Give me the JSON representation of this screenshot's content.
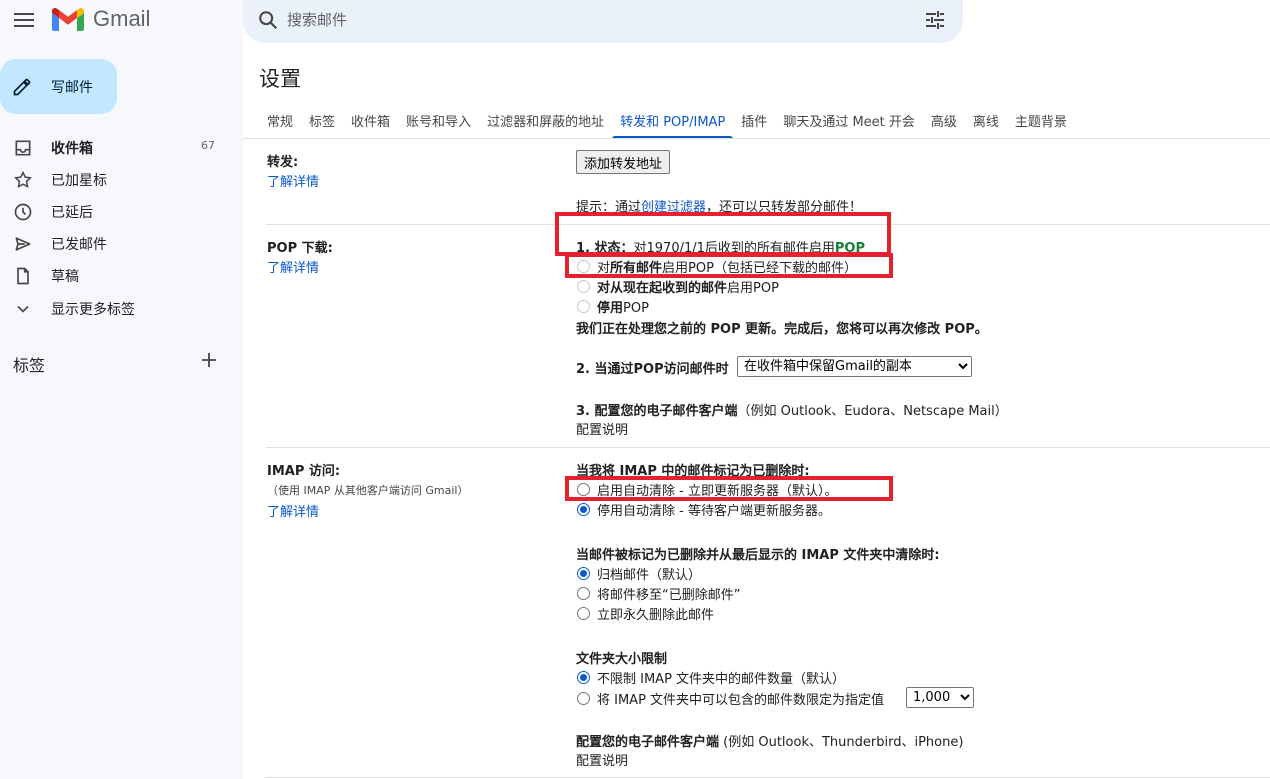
{
  "app": {
    "brand": "Gmail"
  },
  "search": {
    "placeholder": "搜索邮件"
  },
  "compose": {
    "label": "写邮件"
  },
  "nav": [
    {
      "label": "收件箱",
      "count": "67"
    },
    {
      "label": "已加星标"
    },
    {
      "label": "已延后"
    },
    {
      "label": "已发邮件"
    },
    {
      "label": "草稿"
    },
    {
      "label": "显示更多标签"
    }
  ],
  "labels_section": {
    "title": "标签"
  },
  "page": {
    "title": "设置"
  },
  "tabs": [
    "常规",
    "标签",
    "收件箱",
    "账号和导入",
    "过滤器和屏蔽的地址",
    "转发和 POP/IMAP",
    "插件",
    "聊天及通过 Meet 开会",
    "高级",
    "离线",
    "主题背景"
  ],
  "active_tab": "转发和 POP/IMAP",
  "forwarding": {
    "label": "转发:",
    "learn_more": "了解详情",
    "add_button": "添加转发地址",
    "tip_prefix": "提示：通过",
    "tip_link": "创建过滤器",
    "tip_suffix": "，还可以只转发部分邮件！"
  },
  "pop": {
    "label": "POP 下载:",
    "learn_more": "了解详情",
    "status_label": "1. 状态：",
    "status_text": "对1970/1/1后收到的所有邮件启用",
    "status_pop": "POP",
    "opt1_bold": "所有邮件",
    "opt1_pre": "对",
    "opt1_post": "启用POP（包括已经下载的邮件）",
    "opt2_bold": "对从现在起收到的邮件",
    "opt2_post": "启用POP",
    "opt3_bold": "停用",
    "opt3_post": "POP",
    "processing": "我们正在处理您之前的 POP 更新。完成后，您将可以再次修改 POP。",
    "when_access": "2. 当通过POP访问邮件时",
    "when_access_value": "在收件箱中保留Gmail的副本",
    "configure_client_bold": "3. 配置您的电子邮件客户端",
    "configure_client_rest": "（例如 Outlook、Eudora、Netscape Mail）",
    "configure_link": "配置说明"
  },
  "imap": {
    "label": "IMAP 访问:",
    "sub": "（使用 IMAP 从其他客户端访问 Gmail）",
    "learn_more": "了解详情",
    "deleted_head": "当我将 IMAP 中的邮件标记为已删除时:",
    "auto_on": "启用自动清除 - 立即更新服务器（默认）。",
    "auto_off": "停用自动清除 - 等待客户端更新服务器。",
    "expunge_head": "当邮件被标记为已删除并从最后显示的 IMAP 文件夹中清除时:",
    "archive": "归档邮件（默认）",
    "move_trash": "将邮件移至“已删除邮件”",
    "delete_forever": "立即永久删除此邮件",
    "folder_limit_head": "文件夹大小限制",
    "no_limit": "不限制 IMAP 文件夹中的邮件数量（默认）",
    "limit_to": "将 IMAP 文件夹中可以包含的邮件数限定为指定值",
    "limit_value": "1,000",
    "client_bold": "配置您的电子邮件客户端",
    "client_rest": " (例如 Outlook、Thunderbird、iPhone)",
    "config_link": "配置说明"
  },
  "colors": {
    "accent": "#0b57d0",
    "compose_bg": "#c2e7ff",
    "sidebar_bg": "#f6f8fc",
    "highlight_box": "#e5212f",
    "pop_green": "#188038"
  }
}
